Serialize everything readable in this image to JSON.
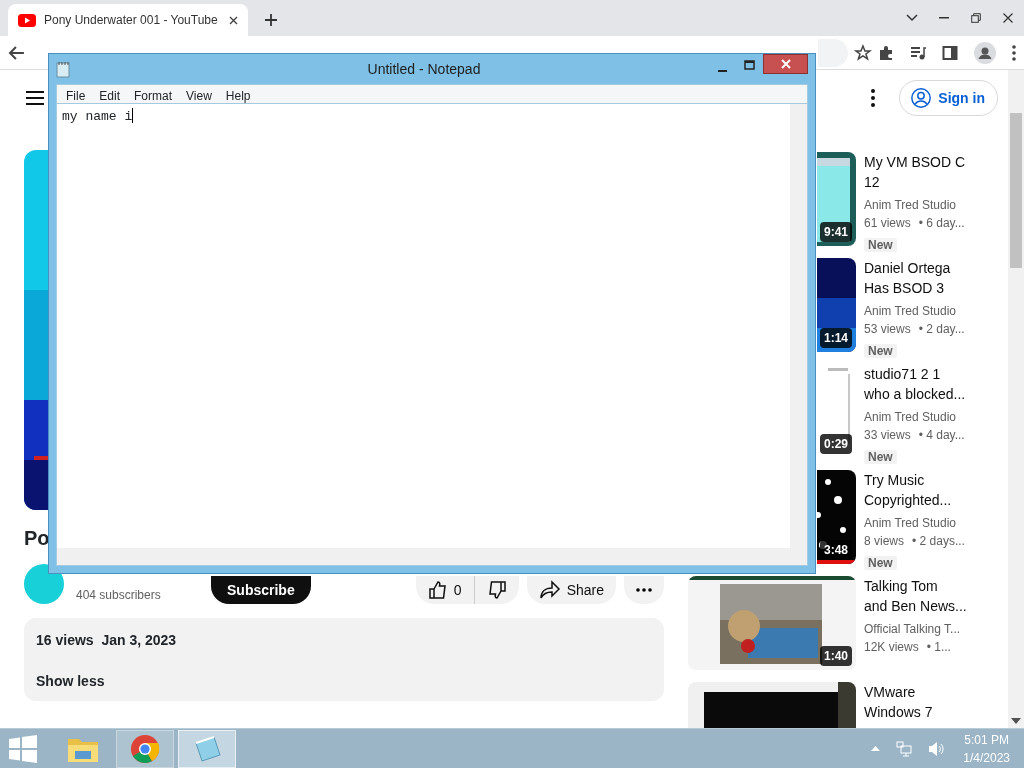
{
  "browser": {
    "tab": {
      "title": "Pony Underwater 001 - YouTube",
      "selected": true
    }
  },
  "youtube": {
    "sign_in": "Sign in",
    "video_title": "Po",
    "subscribers": "404 subscribers",
    "subscribe": "Subscribe",
    "likes": "0",
    "share": "Share",
    "description": {
      "meta": "16 views  Jan 3, 2023",
      "toggle": "Show less"
    }
  },
  "recommendations": [
    {
      "title": [
        "My VM BSOD C",
        "12"
      ],
      "channel": "Anim Tred Studio",
      "views": "61 views",
      "age": "• 6 day...",
      "duration": "9:41",
      "badge": "New"
    },
    {
      "title": [
        "Daniel Ortega",
        "Has BSOD 3"
      ],
      "channel": "Anim Tred Studio",
      "views": "53 views",
      "age": "• 2 day...",
      "duration": "1:14",
      "badge": "New"
    },
    {
      "title": [
        "studio71 2 1",
        "who a blocked..."
      ],
      "channel": "Anim Tred Studio",
      "views": "33 views",
      "age": "• 4 day...",
      "duration": "0:29",
      "badge": "New"
    },
    {
      "title": [
        "Try Music",
        "Copyrighted..."
      ],
      "channel": "Anim Tred Studio",
      "views": "8 views",
      "age": "• 2 days...",
      "duration": "3:48",
      "badge": "New"
    },
    {
      "title": [
        "Talking Tom",
        "and Ben News..."
      ],
      "channel": "Official Talking T...",
      "views": "12K views",
      "age": "• 1...",
      "duration": "1:40"
    },
    {
      "title": [
        "VMware",
        "Windows 7"
      ]
    }
  ],
  "notepad": {
    "title": "Untitled - Notepad",
    "menu": [
      "File",
      "Edit",
      "Format",
      "View",
      "Help"
    ],
    "text": "my name i"
  },
  "taskbar": {
    "apps": [
      {
        "kind": "explorer",
        "running": false,
        "selected": false
      },
      {
        "kind": "chrome",
        "running": true,
        "selected": false
      },
      {
        "kind": "notepad",
        "running": true,
        "selected": true
      }
    ],
    "clock": {
      "time": "5:01 PM",
      "date": "1/4/2023"
    }
  }
}
